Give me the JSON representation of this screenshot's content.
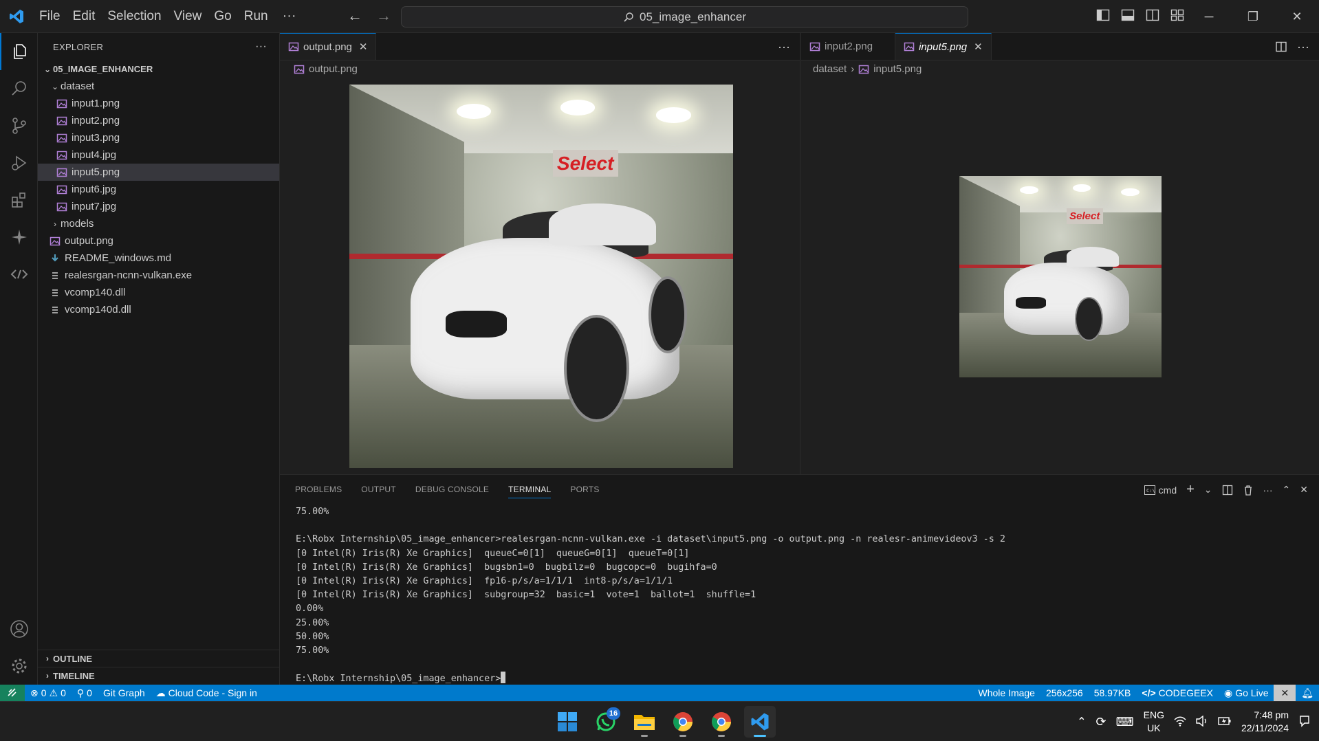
{
  "menu": [
    "File",
    "Edit",
    "Selection",
    "View",
    "Go",
    "Run"
  ],
  "menu_more": "···",
  "search": {
    "text": "05_image_enhancer"
  },
  "explorer": {
    "title": "EXPLORER",
    "more": "···",
    "root": "05_IMAGE_ENHANCER",
    "items": [
      {
        "label": "dataset",
        "kind": "folder-open"
      },
      {
        "label": "input1.png",
        "kind": "image"
      },
      {
        "label": "input2.png",
        "kind": "image"
      },
      {
        "label": "input3.png",
        "kind": "image"
      },
      {
        "label": "input4.jpg",
        "kind": "image"
      },
      {
        "label": "input5.png",
        "kind": "image"
      },
      {
        "label": "input6.jpg",
        "kind": "image"
      },
      {
        "label": "input7.jpg",
        "kind": "image"
      },
      {
        "label": "models",
        "kind": "folder"
      },
      {
        "label": "output.png",
        "kind": "image"
      },
      {
        "label": "README_windows.md",
        "kind": "markdown"
      },
      {
        "label": "realesrgan-ncnn-vulkan.exe",
        "kind": "file"
      },
      {
        "label": "vcomp140.dll",
        "kind": "file"
      },
      {
        "label": "vcomp140d.dll",
        "kind": "file"
      }
    ],
    "outline": "OUTLINE",
    "timeline": "TIMELINE"
  },
  "editor_left": {
    "tab": "output.png",
    "breadcrumb": "output.png",
    "image_sign": "Select"
  },
  "editor_right": {
    "tabs": [
      "input2.png",
      "input5.png"
    ],
    "breadcrumb": [
      "dataset",
      "input5.png"
    ],
    "image_sign": "Select"
  },
  "panel": {
    "tabs": [
      "PROBLEMS",
      "OUTPUT",
      "DEBUG CONSOLE",
      "TERMINAL",
      "PORTS"
    ],
    "shell": "cmd",
    "terminal_lines": [
      "75.00%",
      "",
      "E:\\Robx Internship\\05_image_enhancer>realesrgan-ncnn-vulkan.exe -i dataset\\input5.png -o output.png -n realesr-animevideov3 -s 2",
      "[0 Intel(R) Iris(R) Xe Graphics]  queueC=0[1]  queueG=0[1]  queueT=0[1]",
      "[0 Intel(R) Iris(R) Xe Graphics]  bugsbn1=0  bugbilz=0  bugcopc=0  bugihfa=0",
      "[0 Intel(R) Iris(R) Xe Graphics]  fp16-p/s/a=1/1/1  int8-p/s/a=1/1/1",
      "[0 Intel(R) Iris(R) Xe Graphics]  subgroup=32  basic=1  vote=1  ballot=1  shuffle=1",
      "0.00%",
      "25.00%",
      "50.00%",
      "75.00%",
      ""
    ],
    "prompt": "E:\\Robx Internship\\05_image_enhancer>"
  },
  "status": {
    "errors": "0",
    "warnings": "0",
    "ports": "0",
    "git_graph": "Git Graph",
    "cloud_code": "Cloud Code - Sign in",
    "whole_image": "Whole Image",
    "dimensions": "256x256",
    "size": "58.97KB",
    "codegeex": "CODEGEEX",
    "go_live": "Go Live"
  },
  "taskbar": {
    "whatsapp_badge": "16",
    "lang_top": "ENG",
    "lang_bottom": "UK",
    "time": "7:48 pm",
    "date": "22/11/2024"
  },
  "colors": {
    "accent": "#0078d4",
    "statusbar": "#007acc",
    "remote": "#16825d",
    "image_icon": "#b180d7"
  }
}
